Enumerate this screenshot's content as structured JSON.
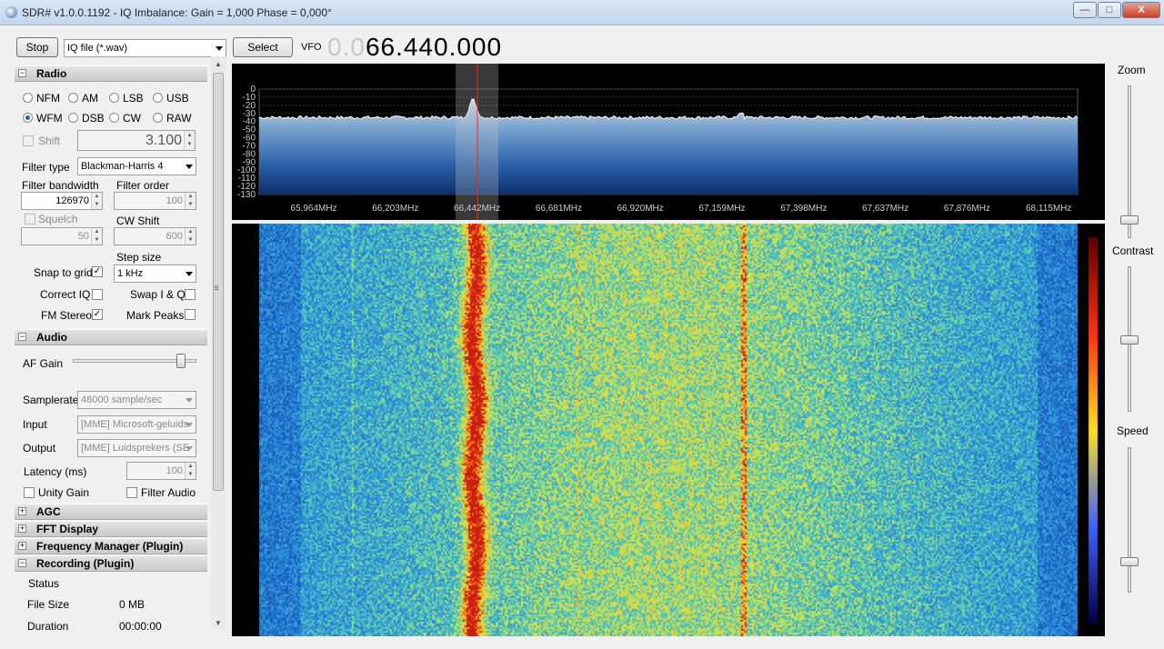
{
  "window": {
    "title": "SDR# v1.0.0.1192 - IQ Imbalance: Gain = 1,000 Phase = 0,000°",
    "minimize": "—",
    "maximize": "□",
    "close": "X"
  },
  "toolbar": {
    "stop_label": "Stop",
    "source_value": "IQ file (*.wav)",
    "select_label": "Select",
    "vfo_label": "VFO",
    "vfo_prefix": "0.0",
    "vfo_value": "66.440.000"
  },
  "radio": {
    "header": "Radio",
    "modes": [
      "NFM",
      "AM",
      "LSB",
      "USB",
      "WFM",
      "DSB",
      "CW",
      "RAW"
    ],
    "selected_mode": "WFM",
    "shift_label": "Shift",
    "shift_value": "3.100",
    "filter_type_label": "Filter type",
    "filter_type_value": "Blackman-Harris 4",
    "filter_bandwidth_label": "Filter bandwidth",
    "filter_bandwidth_value": "126970",
    "filter_order_label": "Filter order",
    "filter_order_value": "100",
    "squelch_label": "Squelch",
    "squelch_value": "50",
    "cw_shift_label": "CW Shift",
    "cw_shift_value": "600",
    "step_size_label": "Step size",
    "step_size_value": "1 kHz",
    "snap_label": "Snap to grid",
    "snap_checked": "✓",
    "correct_iq_label": "Correct IQ",
    "swap_iq_label": "Swap I & Q",
    "fm_stereo_label": "FM Stereo",
    "fm_stereo_checked": "✓",
    "mark_peaks_label": "Mark Peaks"
  },
  "audio": {
    "header": "Audio",
    "af_gain_label": "AF Gain",
    "af_gain_level": 0.9,
    "samplerate_label": "Samplerate",
    "samplerate_value": "48000 sample/sec",
    "input_label": "Input",
    "input_value": "[MME] Microsoft-geluids",
    "output_label": "Output",
    "output_value": "[MME] Luidsprekers (SE",
    "latency_label": "Latency (ms)",
    "latency_value": "100",
    "unity_gain_label": "Unity Gain",
    "filter_audio_label": "Filter Audio"
  },
  "sections": {
    "agc": "AGC",
    "fft": "FFT Display",
    "freq_mgr": "Frequency Manager (Plugin)",
    "recording": "Recording (Plugin)"
  },
  "recording": {
    "status_label": "Status",
    "file_size_label": "File Size",
    "file_size_value": "0 MB",
    "duration_label": "Duration",
    "duration_value": "00:00:00"
  },
  "right_panel": {
    "zoom_label": "Zoom",
    "contrast_label": "Contrast",
    "speed_label": "Speed",
    "zoom_level": 0.1,
    "contrast_level": 0.5,
    "speed_level": 0.2
  },
  "spectrum": {
    "db_ticks": [
      "0",
      "-10",
      "-20",
      "-30",
      "-40",
      "-50",
      "-60",
      "-70",
      "-80",
      "-90",
      "-100",
      "-110",
      "-120",
      "-130"
    ],
    "freq_ticks": [
      "65,964MHz",
      "66,203MHz",
      "66,442MHz",
      "66,681MHz",
      "66,920MHz",
      "67,159MHz",
      "67,398MHz",
      "67,637MHz",
      "67,876MHz",
      "68,115MHz"
    ]
  },
  "colors": {
    "accent": "#2a5fa8",
    "marker": "#ff2020",
    "waterfall_base": "#2b6fc0"
  }
}
